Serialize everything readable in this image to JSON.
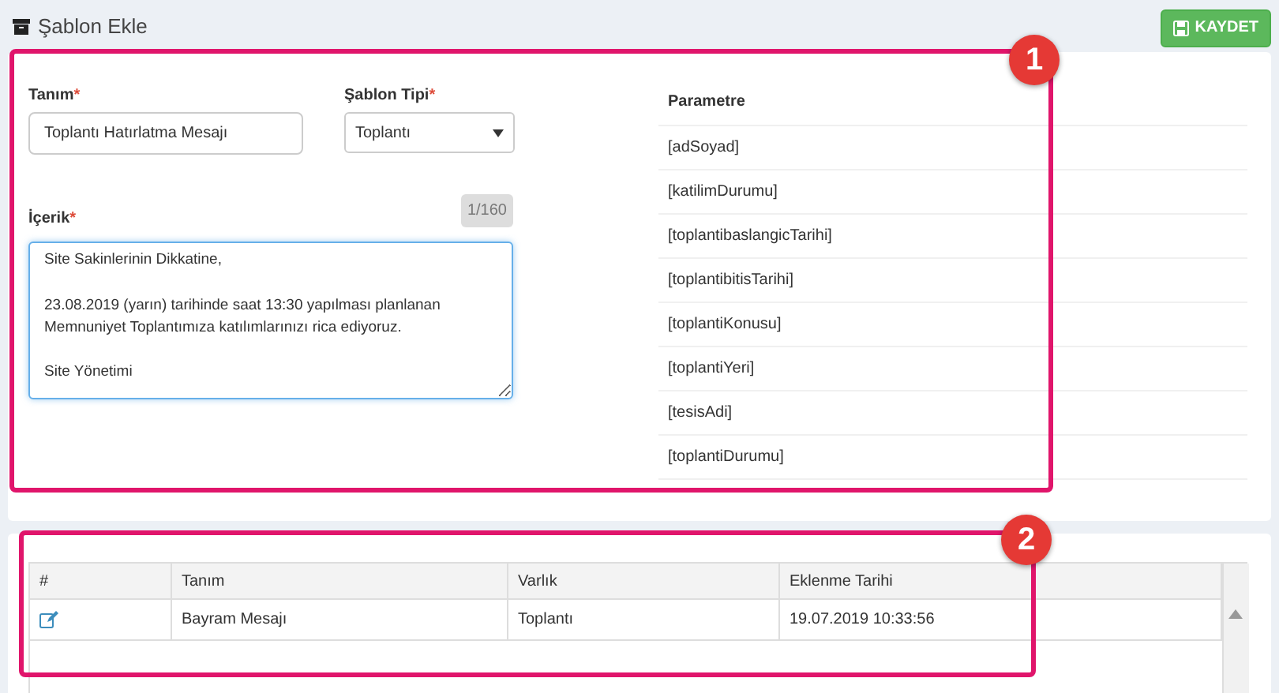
{
  "page": {
    "title": "Şablon Ekle",
    "save_button": "KAYDET"
  },
  "form": {
    "name_label": "Tanım",
    "name_value": "Toplantı Hatırlatma Mesajı",
    "type_label": "Şablon Tipi",
    "type_value": "Toplantı",
    "content_label": "İçerik",
    "counter": "1/160",
    "content_value": "Site Sakinlerinin Dikkatine,\n\n23.08.2019 (yarın) tarihinde saat 13:30 yapılması planlanan Memnuniyet Toplantımıza katılımlarınızı rica ediyoruz.\n\nSite Yönetimi",
    "required_mark": "*"
  },
  "parameters": {
    "header": "Parametre",
    "rows": [
      "[adSoyad]",
      "[katilimDurumu]",
      "[toplantibaslangicTarihi]",
      "[toplantibitisTarihi]",
      "[toplantiKonusu]",
      "[toplantiYeri]",
      "[tesisAdi]",
      "[toplantiDurumu]"
    ]
  },
  "table": {
    "columns": [
      "#",
      "Tanım",
      "Varlık",
      "Eklenme Tarihi"
    ],
    "rows": [
      {
        "name": "Bayram Mesajı",
        "entity": "Toplantı",
        "date": "19.07.2019 10:33:56"
      }
    ]
  },
  "annotations": [
    {
      "number": "1"
    },
    {
      "number": "2"
    }
  ]
}
